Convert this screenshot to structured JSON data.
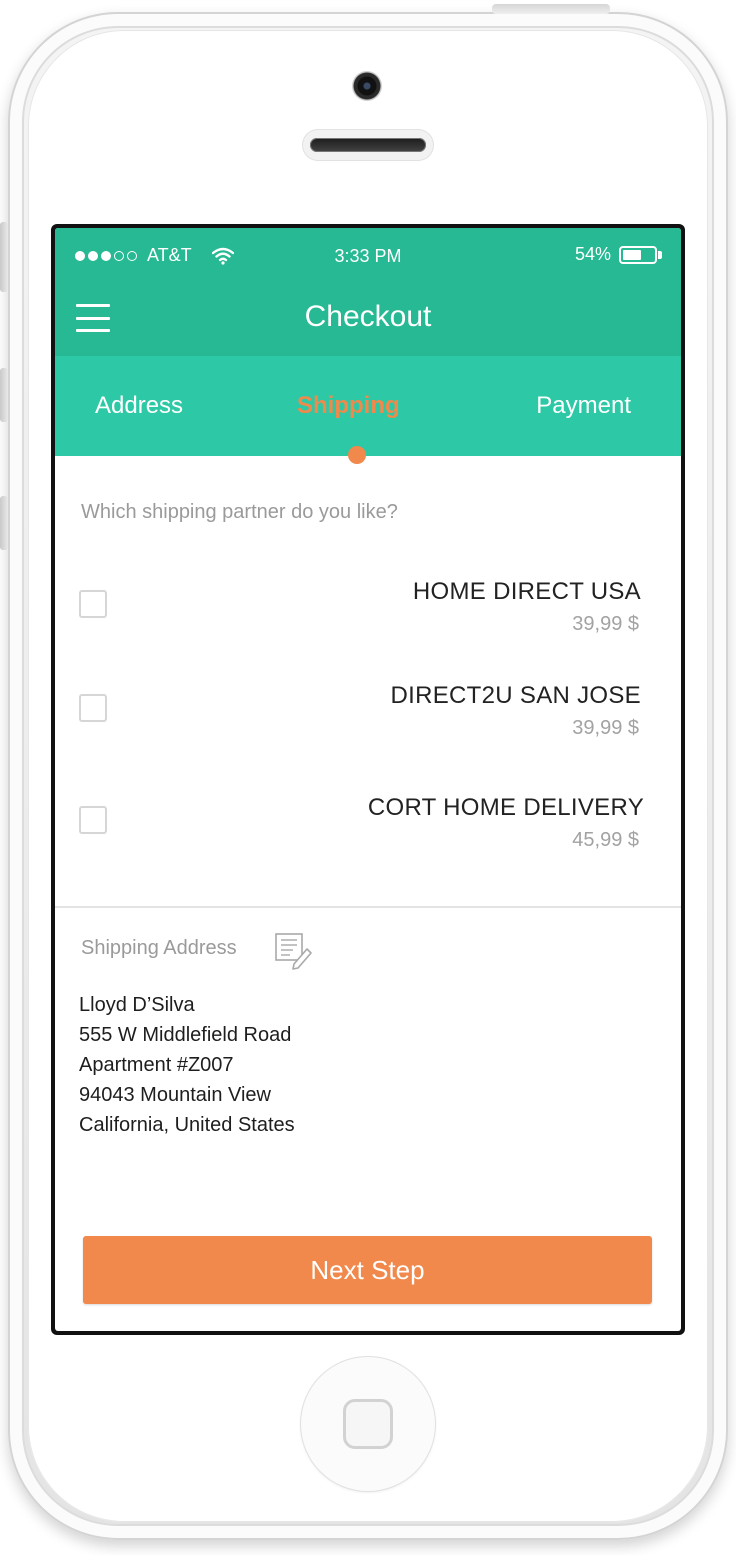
{
  "status_bar": {
    "carrier": "AT&T",
    "time": "3:33 PM",
    "battery": "54%",
    "battery_level": 0.54,
    "signal_bars_filled": 3,
    "signal_bars_total": 5
  },
  "app_bar": {
    "title": "Checkout",
    "menu_icon": "hamburger-menu-icon"
  },
  "tabs": [
    {
      "label": "Address",
      "active": false
    },
    {
      "label": "Shipping",
      "active": true
    },
    {
      "label": "Payment",
      "active": false
    }
  ],
  "shipping": {
    "question": "Which shipping partner do you like?",
    "options": [
      {
        "name": "HOME DIRECT USA",
        "price": "39,99 $",
        "checked": false
      },
      {
        "name": "DIRECT2U SAN JOSE",
        "price": "39,99 $",
        "checked": false
      },
      {
        "name": "CORT HOME DELIVERY",
        "price": "45,99 $",
        "checked": false
      }
    ]
  },
  "shipping_address": {
    "label": "Shipping Address",
    "edit_icon": "edit-note-icon",
    "lines": [
      "Lloyd D’Silva",
      "555 W Middlefield Road",
      "Apartment #Z007",
      "94043 Mountain View",
      "California, United States"
    ]
  },
  "actions": {
    "next_label": "Next Step"
  },
  "colors": {
    "primary": "#26b993",
    "tabs_bg": "#2dc9a6",
    "accent": "#f0894b"
  }
}
